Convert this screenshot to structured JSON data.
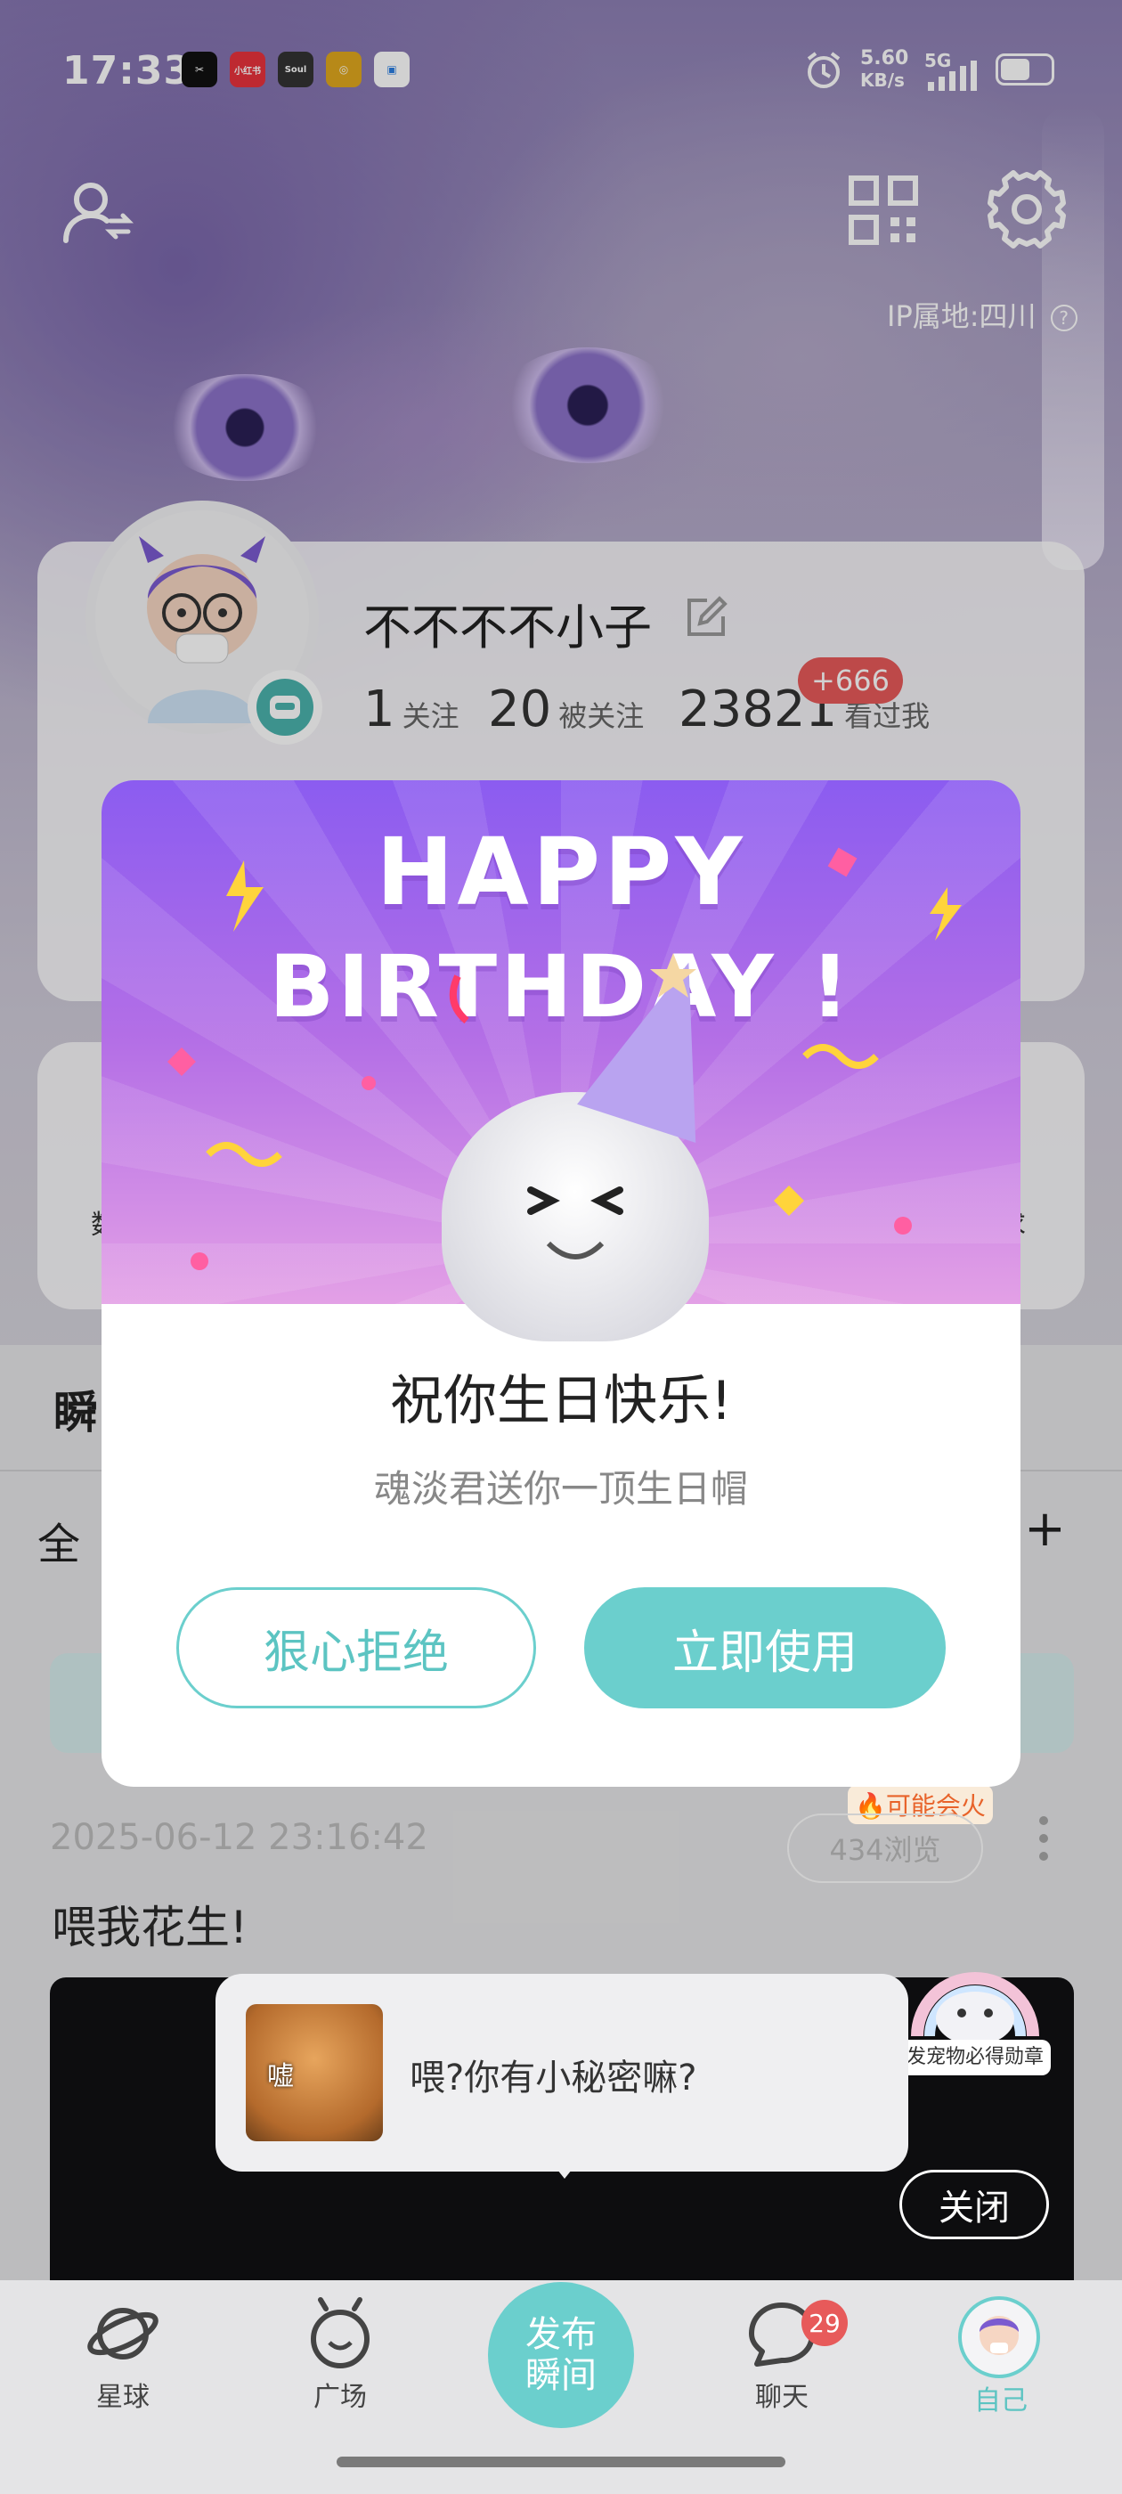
{
  "status_bar": {
    "time": "17:33",
    "apps": [
      "✂",
      "小红书",
      "Soul",
      "◎",
      "▣"
    ],
    "net_speed": "5.60",
    "net_unit": "KB/s",
    "network": "5G"
  },
  "header": {
    "ip_location": "IP属地:四川",
    "help_glyph": "?"
  },
  "profile": {
    "nickname": "不不不不小子",
    "following_count": "1",
    "following_label": "关注",
    "followers_count": "20",
    "followers_label": "被关注",
    "visitors_count": "23821",
    "visitors_label": "看过我",
    "visitors_new_badge": "+666"
  },
  "background_peek": {
    "left_char": "数",
    "right_char": "求",
    "tab_initial": "瞬",
    "filter_initial": "全",
    "add_glyph": "+"
  },
  "birthday_dialog": {
    "banner_line1": "HAPPY",
    "banner_line2": "BIRTHDAY !",
    "title": "祝你生日快乐!",
    "subtitle": "魂淡君送你一顶生日帽",
    "reject_label": "狠心拒绝",
    "accept_label": "立即使用"
  },
  "post": {
    "date": "2025-06-12 23:16:42",
    "hot_tag": "🔥可能会火",
    "views": "434浏览",
    "text": "喂我花生!",
    "tooltip_text": "喂?你有小秘密嘛?",
    "tooltip_image_caption": "嘘",
    "promo_text": "发宠物必得勋章",
    "close_label": "关闭"
  },
  "tab_bar": {
    "planet": "星球",
    "square": "广场",
    "publish_line1": "发布",
    "publish_line2": "瞬间",
    "chat": "聊天",
    "chat_badge": "29",
    "me": "自己"
  },
  "colors": {
    "accent": "#6bcfcd",
    "badge_red": "#e75a5a",
    "dialog_purple": "#8b5cf0"
  }
}
